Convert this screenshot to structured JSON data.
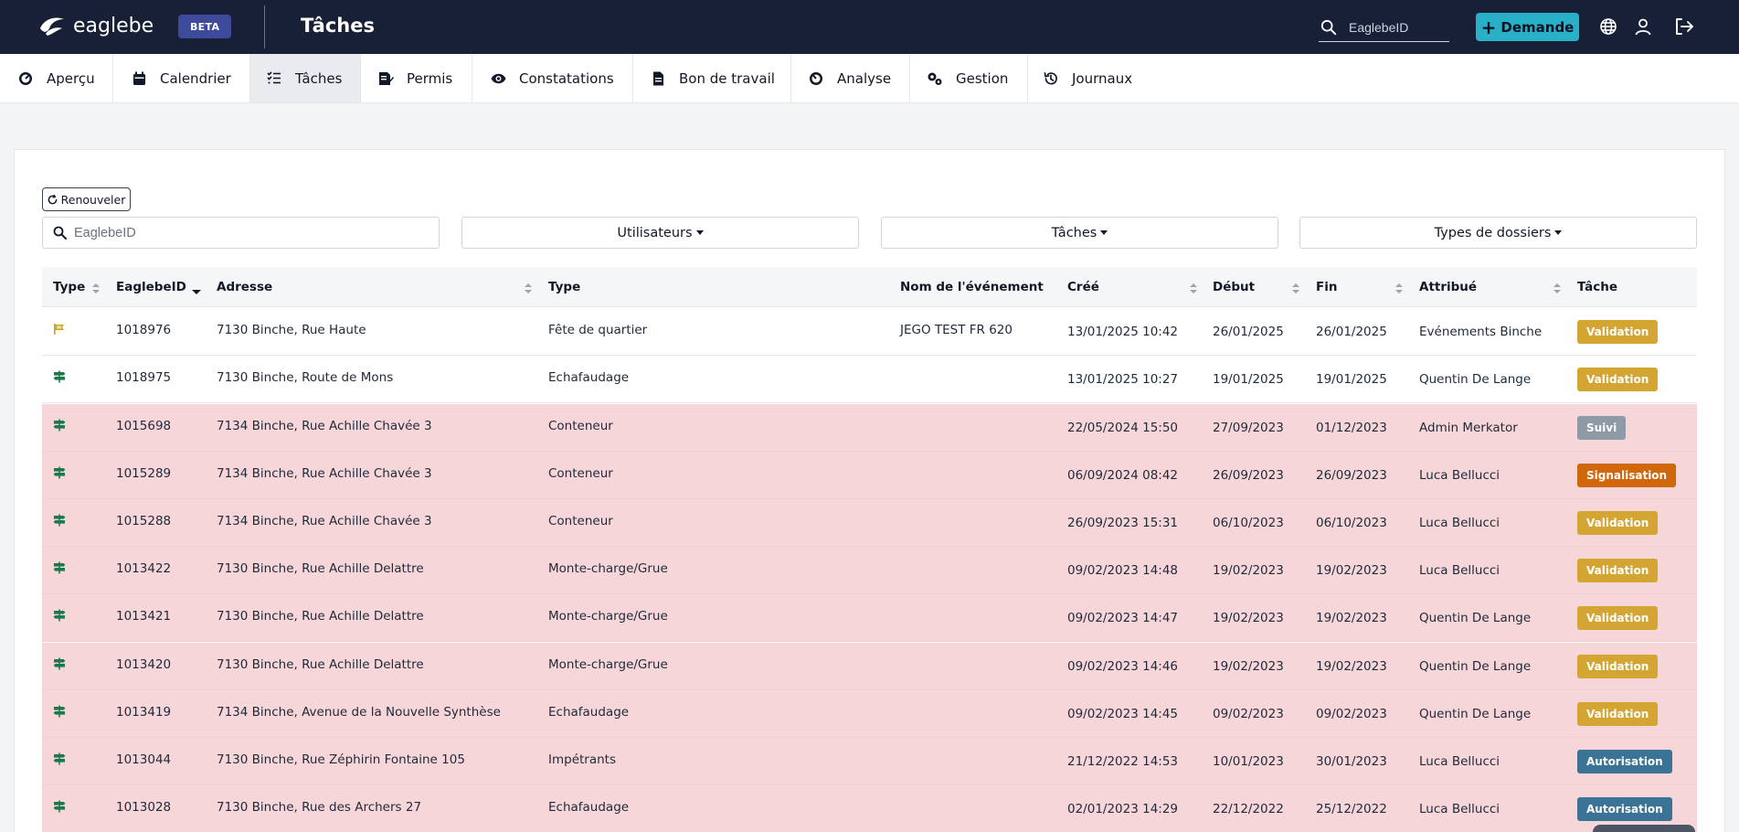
{
  "app": {
    "brand": "eaglebe",
    "beta": "BETA",
    "page_title": "Tâches",
    "search_placeholder": "EaglebeID",
    "demande_label": "Demande",
    "icons": [
      "globe-icon",
      "user-icon",
      "logout-icon"
    ]
  },
  "nav": [
    {
      "label": "Aperçu",
      "icon": "dashboard-icon",
      "active": false
    },
    {
      "label": "Calendrier",
      "icon": "calendar-icon",
      "active": false
    },
    {
      "label": "Tâches",
      "icon": "tasks-icon",
      "active": true
    },
    {
      "label": "Permis",
      "icon": "permit-icon",
      "active": false
    },
    {
      "label": "Constatations",
      "icon": "eye-icon",
      "active": false
    },
    {
      "label": "Bon de travail",
      "icon": "document-icon",
      "active": false
    },
    {
      "label": "Analyse",
      "icon": "analysis-icon",
      "active": false
    },
    {
      "label": "Gestion",
      "icon": "gears-icon",
      "active": false
    },
    {
      "label": "Journaux",
      "icon": "history-icon",
      "active": false
    }
  ],
  "filters": {
    "renew_label": "Renouveler",
    "search_placeholder": "EaglebeID",
    "dropdowns": [
      "Utilisateurs",
      "Tâches",
      "Types de dossiers"
    ]
  },
  "table": {
    "columns": [
      "Type",
      "EaglebeID",
      "Adresse",
      "Type",
      "Nom de l'événement",
      "Créé",
      "Début",
      "Fin",
      "Attribué",
      "Tâche"
    ],
    "rows": [
      {
        "type_icon": "flag-icon",
        "id": "1018976",
        "address": "7130 Binche, Rue Haute",
        "kind": "Fête de quartier",
        "event": "JEGO TEST FR 620",
        "created": "13/01/2025 10:42",
        "start": "26/01/2025",
        "end": "26/01/2025",
        "assigned": "Evénements Binche",
        "task": "Validation",
        "late": false
      },
      {
        "type_icon": "signpost-icon",
        "id": "1018975",
        "address": "7130 Binche, Route de Mons",
        "kind": "Echafaudage",
        "event": "",
        "created": "13/01/2025 10:27",
        "start": "19/01/2025",
        "end": "19/01/2025",
        "assigned": "Quentin De Lange",
        "task": "Validation",
        "late": false
      },
      {
        "type_icon": "signpost-icon",
        "id": "1015698",
        "address": "7134 Binche, Rue Achille Chavée 3",
        "kind": "Conteneur",
        "event": "",
        "created": "22/05/2024 15:50",
        "start": "27/09/2023",
        "end": "01/12/2023",
        "assigned": "Admin Merkator",
        "task": "Suivi",
        "late": true
      },
      {
        "type_icon": "signpost-icon",
        "id": "1015289",
        "address": "7134 Binche, Rue Achille Chavée 3",
        "kind": "Conteneur",
        "event": "",
        "created": "06/09/2024 08:42",
        "start": "26/09/2023",
        "end": "26/09/2023",
        "assigned": "Luca Bellucci",
        "task": "Signalisation",
        "late": true
      },
      {
        "type_icon": "signpost-icon",
        "id": "1015288",
        "address": "7134 Binche, Rue Achille Chavée 3",
        "kind": "Conteneur",
        "event": "",
        "created": "26/09/2023 15:31",
        "start": "06/10/2023",
        "end": "06/10/2023",
        "assigned": "Luca Bellucci",
        "task": "Validation",
        "late": true
      },
      {
        "type_icon": "signpost-icon",
        "id": "1013422",
        "address": "7130 Binche, Rue Achille Delattre",
        "kind": "Monte-charge/Grue",
        "event": "",
        "created": "09/02/2023 14:48",
        "start": "19/02/2023",
        "end": "19/02/2023",
        "assigned": "Luca Bellucci",
        "task": "Validation",
        "late": true
      },
      {
        "type_icon": "signpost-icon",
        "id": "1013421",
        "address": "7130 Binche, Rue Achille Delattre",
        "kind": "Monte-charge/Grue",
        "event": "",
        "created": "09/02/2023 14:47",
        "start": "19/02/2023",
        "end": "19/02/2023",
        "assigned": "Quentin De Lange",
        "task": "Validation",
        "late": true
      },
      {
        "type_icon": "signpost-icon",
        "id": "1013420",
        "address": "7130 Binche, Rue Achille Delattre",
        "kind": "Monte-charge/Grue",
        "event": "",
        "created": "09/02/2023 14:46",
        "start": "19/02/2023",
        "end": "19/02/2023",
        "assigned": "Quentin De Lange",
        "task": "Validation",
        "late": true
      },
      {
        "type_icon": "signpost-icon",
        "id": "1013419",
        "address": "7134 Binche, Avenue de la Nouvelle Synthèse",
        "kind": "Echafaudage",
        "event": "",
        "created": "09/02/2023 14:45",
        "start": "09/02/2023",
        "end": "09/02/2023",
        "assigned": "Quentin De Lange",
        "task": "Validation",
        "late": true
      },
      {
        "type_icon": "signpost-icon",
        "id": "1013044",
        "address": "7130 Binche, Rue Zéphirin Fontaine 105",
        "kind": "Impétrants",
        "event": "",
        "created": "21/12/2022 14:53",
        "start": "10/01/2023",
        "end": "30/01/2023",
        "assigned": "Luca Bellucci",
        "task": "Autorisation",
        "late": true
      },
      {
        "type_icon": "signpost-icon",
        "id": "1013028",
        "address": "7130 Binche, Rue des Archers 27",
        "kind": "Echafaudage",
        "event": "",
        "created": "02/01/2023 14:29",
        "start": "22/12/2022",
        "end": "25/12/2022",
        "assigned": "Luca Bellucci",
        "task": "Autorisation",
        "late": true
      }
    ]
  },
  "badge_colors": {
    "Validation": "#d4a532",
    "Suivi": "#8e9aa6",
    "Signalisation": "#d0680b",
    "Autorisation": "#3b7396"
  },
  "colors": {
    "topbar": "#172036",
    "accent": "#29b0c9",
    "late_row": "#f7d6da",
    "type_icon_green": "#1a7a4d",
    "type_icon_yellow": "#c9a227"
  }
}
